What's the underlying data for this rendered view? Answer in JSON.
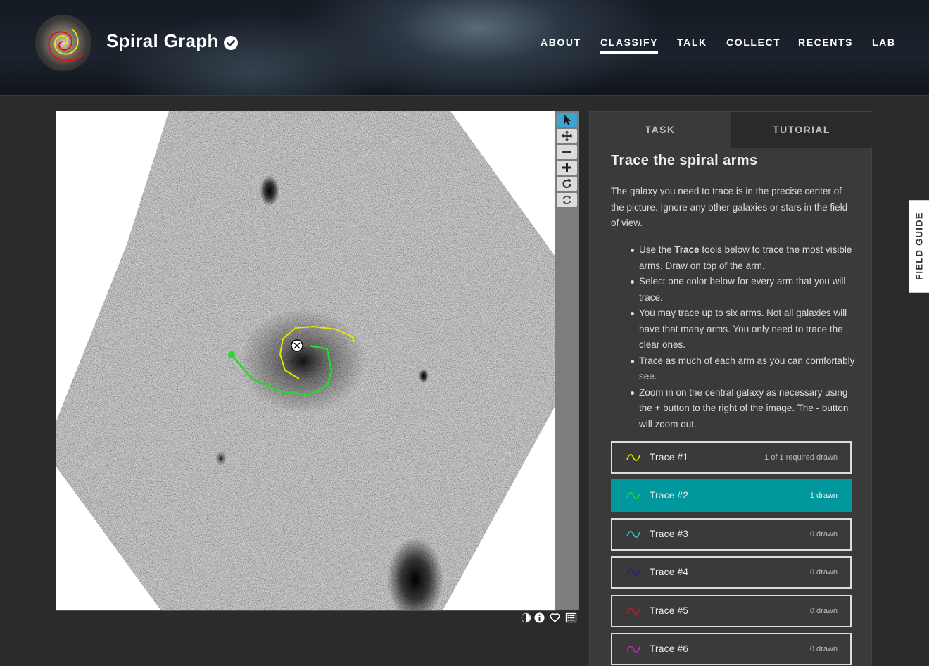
{
  "header": {
    "project_title": "Spiral Graph",
    "verified_icon": "check-badge-icon",
    "nav": [
      "ABOUT",
      "CLASSIFY",
      "TALK",
      "COLLECT",
      "RECENTS",
      "LAB"
    ],
    "active_nav": "CLASSIFY"
  },
  "viewer": {
    "tools": [
      "pointer-icon",
      "pan-icon",
      "zoom-out-icon",
      "zoom-in-icon",
      "rotate-icon",
      "reset-icon"
    ],
    "active_tool": "pointer-icon",
    "meta_icons": [
      "invert-icon",
      "info-icon",
      "favorite-icon",
      "collections-icon"
    ]
  },
  "task_panel": {
    "tabs": [
      "TASK",
      "TUTORIAL"
    ],
    "active_tab": "TASK",
    "title": "Trace the spiral arms",
    "intro": "The galaxy you need to trace is in the precise center of the picture. Ignore any other galaxies or stars in the field of view.",
    "instructions": [
      {
        "before": "Use the ",
        "bold": "Trace",
        "after": " tools below to trace the most visible arms. Draw on top of the arm."
      },
      {
        "before": "Select one color below for every arm that you will trace.",
        "bold": "",
        "after": ""
      },
      {
        "before": "You may trace up to six arms. Not all galaxies will have that many arms. You only need to trace the clear ones.",
        "bold": "",
        "after": ""
      },
      {
        "before": "Trace as much of each arm as you can comfortably see.",
        "bold": "",
        "after": ""
      },
      {
        "before": "Zoom in on the central galaxy as necessary using the ",
        "bold": "+",
        "after": " button to the right of the image. The "
      },
      {
        "before": "",
        "bold": "-",
        "after": " button will zoom out."
      }
    ],
    "traces": [
      {
        "label": "Trace #1",
        "count": "1 of 1 required drawn",
        "color": "#e6e600",
        "selected": false
      },
      {
        "label": "Trace #2",
        "count": "1 drawn",
        "color": "#22dd22",
        "selected": true
      },
      {
        "label": "Trace #3",
        "count": "0 drawn",
        "color": "#22cccc",
        "selected": false
      },
      {
        "label": "Trace #4",
        "count": "0 drawn",
        "color": "#1a1aa8",
        "selected": false
      },
      {
        "label": "Trace #5",
        "count": "0 drawn",
        "color": "#cc1a1a",
        "selected": false
      },
      {
        "label": "Trace #6",
        "count": "0 drawn",
        "color": "#cc22cc",
        "selected": false
      }
    ]
  },
  "field_guide": {
    "label": "FIELD GUIDE"
  }
}
